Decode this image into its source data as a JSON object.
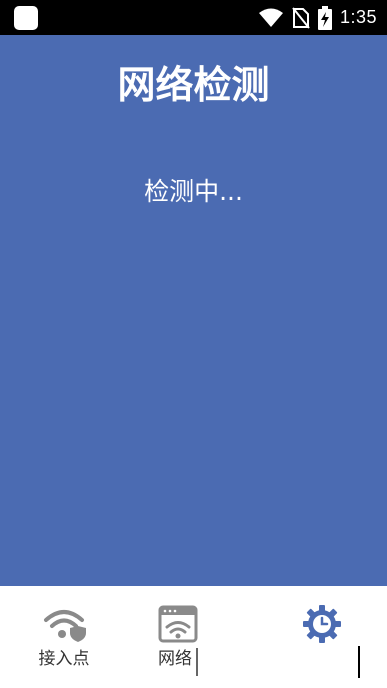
{
  "status_bar": {
    "time": "1:35",
    "icons": [
      "app-icon",
      "wifi-icon",
      "no-sim-icon",
      "battery-charging-icon"
    ]
  },
  "main": {
    "title": "网络检测",
    "status": "检测中...",
    "background": "#4b6bb2"
  },
  "bottom_nav": {
    "items": [
      {
        "label": "接入点",
        "icon": "wifi-shield-icon",
        "active": false
      },
      {
        "label": "网络",
        "icon": "network-window-icon",
        "active": false
      },
      {
        "label": "",
        "icon": "gear-clock-icon",
        "active": true
      }
    ],
    "active_color": "#4b6bb2",
    "inactive_color": "#8a8a8a"
  }
}
